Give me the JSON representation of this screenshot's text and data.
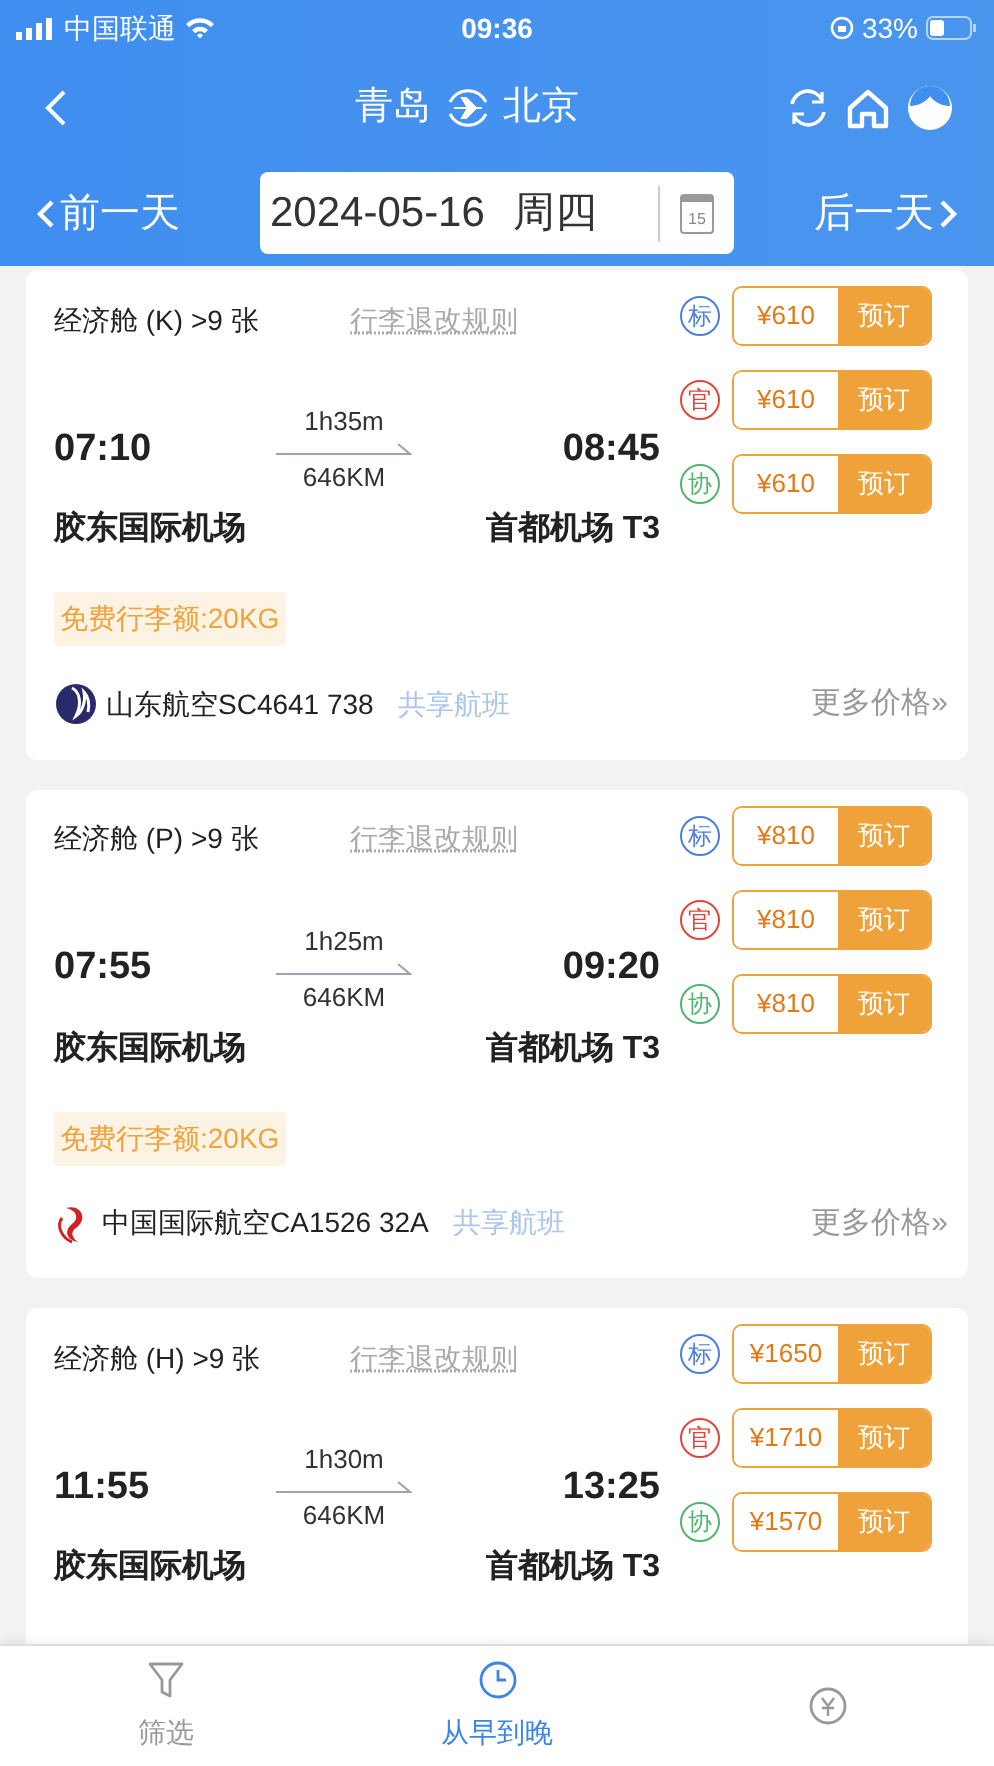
{
  "status_bar": {
    "carrier": "中国联通",
    "time": "09:36",
    "battery": "33%"
  },
  "nav": {
    "from": "青岛",
    "to": "北京"
  },
  "date_bar": {
    "prev": "前一天",
    "date": "2024-05-16",
    "weekday": "周四",
    "calendar_day": "15",
    "next": "后一天"
  },
  "flights": [
    {
      "cabin": "经济舱 (K) >9 张",
      "rules": "行李退改规则",
      "depart": "07:10",
      "duration": "1h35m",
      "distance": "646KM",
      "arrive": "08:45",
      "from_airport": "胶东国际机场",
      "to_airport": "首都机场 T3",
      "baggage": "免费行李额:20KG",
      "airline": {
        "kind": "shandong",
        "text": "山东航空SC4641 738"
      },
      "shared": "共享航班",
      "more": "更多价格»",
      "fares": [
        {
          "tag": "标",
          "color": "#4a7fdc",
          "price": "¥610",
          "book": "预订"
        },
        {
          "tag": "官",
          "color": "#e0453a",
          "price": "¥610",
          "book": "预订"
        },
        {
          "tag": "协",
          "color": "#52b46e",
          "price": "¥610",
          "book": "预订"
        }
      ]
    },
    {
      "cabin": "经济舱 (P) >9 张",
      "rules": "行李退改规则",
      "depart": "07:55",
      "duration": "1h25m",
      "distance": "646KM",
      "arrive": "09:20",
      "from_airport": "胶东国际机场",
      "to_airport": "首都机场 T3",
      "baggage": "免费行李额:20KG",
      "airline": {
        "kind": "airchina",
        "text": "中国国际航空CA1526 32A"
      },
      "shared": "共享航班",
      "more": "更多价格»",
      "fares": [
        {
          "tag": "标",
          "color": "#4a7fdc",
          "price": "¥810",
          "book": "预订"
        },
        {
          "tag": "官",
          "color": "#e0453a",
          "price": "¥810",
          "book": "预订"
        },
        {
          "tag": "协",
          "color": "#52b46e",
          "price": "¥810",
          "book": "预订"
        }
      ]
    },
    {
      "cabin": "经济舱 (H) >9 张",
      "rules": "行李退改规则",
      "depart": "11:55",
      "duration": "1h30m",
      "distance": "646KM",
      "arrive": "13:25",
      "from_airport": "胶东国际机场",
      "to_airport": "首都机场 T3",
      "fares": [
        {
          "tag": "标",
          "color": "#4a7fdc",
          "price": "¥1650",
          "book": "预订"
        },
        {
          "tag": "官",
          "color": "#e0453a",
          "price": "¥1710",
          "book": "预订"
        },
        {
          "tag": "协",
          "color": "#52b46e",
          "price": "¥1570",
          "book": "预订"
        }
      ]
    }
  ],
  "tab_bar": [
    {
      "kind": "filter",
      "label": "筛选",
      "selected": false
    },
    {
      "kind": "time",
      "label": "从早到晚",
      "selected": true
    },
    {
      "kind": "price",
      "selected": false
    }
  ]
}
